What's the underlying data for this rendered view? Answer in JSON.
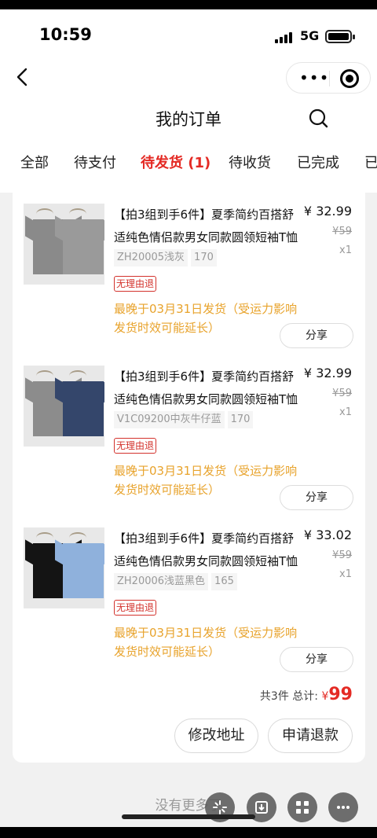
{
  "status_bar": {
    "time": "10:59",
    "network": "5G"
  },
  "header": {
    "title": "我的订单"
  },
  "tabs": [
    {
      "label": "全部"
    },
    {
      "label": "待支付"
    },
    {
      "label": "待发货 (1)"
    },
    {
      "label": "待收货"
    },
    {
      "label": "已完成"
    },
    {
      "label": "已"
    }
  ],
  "order": {
    "items": [
      {
        "name": "【拍3组到手6件】夏季简约百搭舒适纯色情侣款男女同款圆领短袖T恤",
        "spec_color": "ZH20005浅灰",
        "spec_size": "170",
        "tag": "无理由退",
        "shipping": "最晚于03月31日发货（受运力影响发货时效可能延长）",
        "price": "¥ 32.99",
        "original_price": "¥59",
        "quantity": "x1",
        "share_label": "分享",
        "colors": [
          "#8a8a8a",
          "#9a9a9a"
        ]
      },
      {
        "name": "【拍3组到手6件】夏季简约百搭舒适纯色情侣款男女同款圆领短袖T恤",
        "spec_color": "V1C09200中灰牛仔蓝",
        "spec_size": "170",
        "tag": "无理由退",
        "shipping": "最晚于03月31日发货（受运力影响发货时效可能延长）",
        "price": "¥ 32.99",
        "original_price": "¥59",
        "quantity": "x1",
        "share_label": "分享",
        "colors": [
          "#8c8c8c",
          "#34466b"
        ]
      },
      {
        "name": "【拍3组到手6件】夏季简约百搭舒适纯色情侣款男女同款圆领短袖T恤",
        "spec_color": "ZH20006浅蓝黑色",
        "spec_size": "165",
        "tag": "无理由退",
        "shipping": "最晚于03月31日发货（受运力影响发货时效可能延长）",
        "price": "¥ 33.02",
        "original_price": "¥59",
        "quantity": "x1",
        "share_label": "分享",
        "colors": [
          "#141414",
          "#8fb1dc"
        ]
      }
    ],
    "summary": {
      "count_label": "共3件",
      "total_label": "总计:",
      "currency": "¥",
      "total": "99"
    },
    "actions": {
      "modify_address": "修改地址",
      "refund": "申请退款"
    }
  },
  "footer": {
    "no_more": "没有更多了"
  },
  "accent_color": "#e42a24",
  "warning_color": "#e8a32c"
}
